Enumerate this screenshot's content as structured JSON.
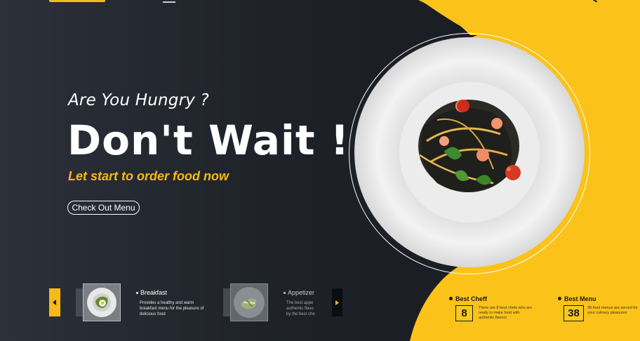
{
  "hero": {
    "subtitle": "Are You Hungry ?",
    "title": "Don't Wait !",
    "tagline": "Let start to order food now",
    "cta_label": "Check Out Menu"
  },
  "colors": {
    "accent": "#f6b91a",
    "dark": "#1e2128",
    "text": "#ffffff"
  },
  "icons": {
    "prev": "chevron-left-icon",
    "next": "chevron-right-icon",
    "menu": "hamburger-menu-icon"
  },
  "cards": [
    {
      "title": "Breakfast",
      "description": "Provides a healthy and warm breakfast menu for the pleasure of delicious food",
      "active": true
    },
    {
      "title": "Appetizer",
      "description": "The best appe authentic flavo by the best che",
      "active": false
    }
  ],
  "stats": [
    {
      "title": "Best Cheff",
      "value": "8",
      "description": "There are 8 best chefs who are ready to make food with authentic flavors"
    },
    {
      "title": "Best Menu",
      "value": "38",
      "description": "38 food menus are served for your culinary pleasures"
    }
  ]
}
